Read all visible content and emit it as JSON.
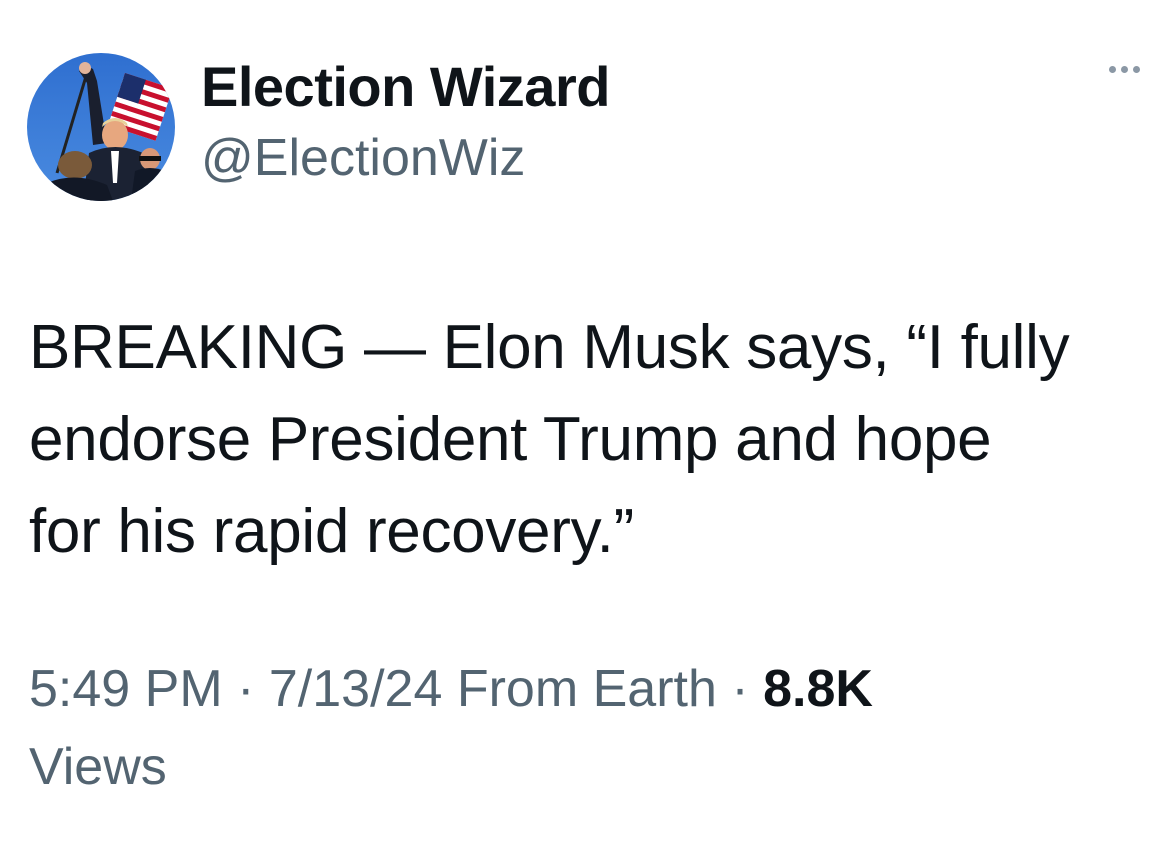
{
  "author": {
    "display_name": "Election Wizard",
    "handle": "@ElectionWiz",
    "avatar_icon": "profile-photo"
  },
  "menu": {
    "icon": "more-horizontal-icon"
  },
  "tweet": {
    "text_line_1": "BREAKING — Elon Musk says, “I fully",
    "text_line_2": "endorse President Trump and hope",
    "text_line_3": "for his rapid recovery.”"
  },
  "meta": {
    "time": "5:49 PM",
    "separator_1": " · ",
    "date": "7/13/24",
    "source": " From Earth",
    "separator_2": " · ",
    "views_count": "8.8K",
    "views_label": "Views"
  },
  "colors": {
    "primary_text": "#0f1419",
    "secondary_text": "#536471",
    "background": "#ffffff"
  }
}
